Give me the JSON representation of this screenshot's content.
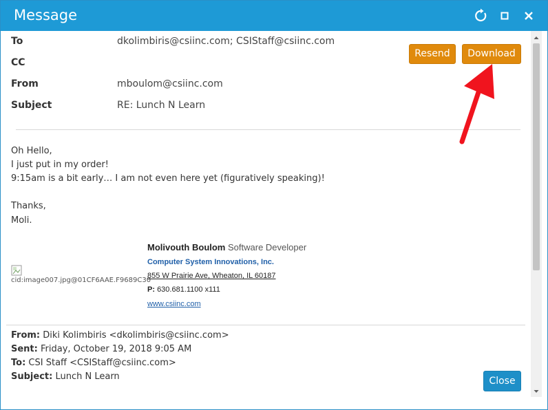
{
  "window": {
    "title": "Message"
  },
  "header": {
    "to_label": "To",
    "to_value": "dkolimbiris@csiinc.com; CSIStaff@csiinc.com",
    "cc_label": "CC",
    "cc_value": "",
    "from_label": "From",
    "from_value": "mboulom@csiinc.com",
    "subject_label": "Subject",
    "subject_value": "RE: Lunch N Learn"
  },
  "actions": {
    "resend_label": "Resend",
    "download_label": "Download",
    "close_label": "Close"
  },
  "body": {
    "lines": [
      "Oh Hello,",
      "I just put in my order!",
      "9:15am is a bit early… I am not even here yet (figuratively speaking)!",
      "Thanks,",
      "Moli."
    ]
  },
  "signature": {
    "image_caption": "cid:image007.jpg@01CF6AAE.F9689C30",
    "name": "Molivouth Boulom",
    "title": "Software Developer",
    "company": "Computer System Innovations, Inc.",
    "address": "855 W Prairie Ave, Wheaton, IL 60187",
    "phone_label": "P:",
    "phone_value": "630.681.1100 x111",
    "website": "www.csiinc.com"
  },
  "quoted": {
    "from_label": "From:",
    "from_value": "Diki Kolimbiris <dkolimbiris@csiinc.com>",
    "sent_label": "Sent:",
    "sent_value": "Friday, October 19, 2018 9:05 AM",
    "to_label": "To:",
    "to_value": "CSI Staff <CSIStaff@csiinc.com>",
    "subject_label": "Subject:",
    "subject_value": "Lunch N Learn"
  },
  "colors": {
    "titlebar": "#1e9ad6",
    "accent_orange": "#e08a0c",
    "close_button": "#1e8fc8",
    "arrow": "#f0141e"
  }
}
